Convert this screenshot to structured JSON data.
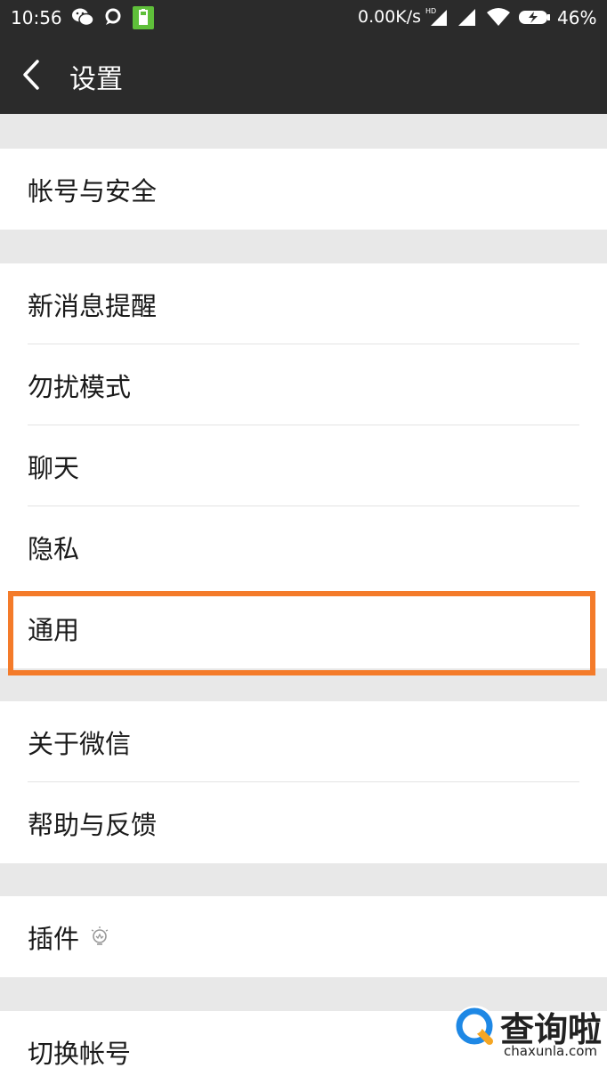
{
  "status_bar": {
    "time": "10:56",
    "net_speed": "0.00K/s",
    "network_badge": "HD",
    "battery": "46%"
  },
  "header": {
    "title": "设置"
  },
  "groups": [
    {
      "items": [
        "帐号与安全"
      ]
    },
    {
      "items": [
        "新消息提醒",
        "勿扰模式",
        "聊天",
        "隐私",
        "通用"
      ]
    },
    {
      "items": [
        "关于微信",
        "帮助与反馈"
      ]
    },
    {
      "items": [
        "插件"
      ]
    },
    {
      "items": [
        "切换帐号"
      ]
    }
  ],
  "highlight_color": "#f47b2a",
  "watermark": {
    "text": "查询啦",
    "sub": "chaxunla.com"
  }
}
